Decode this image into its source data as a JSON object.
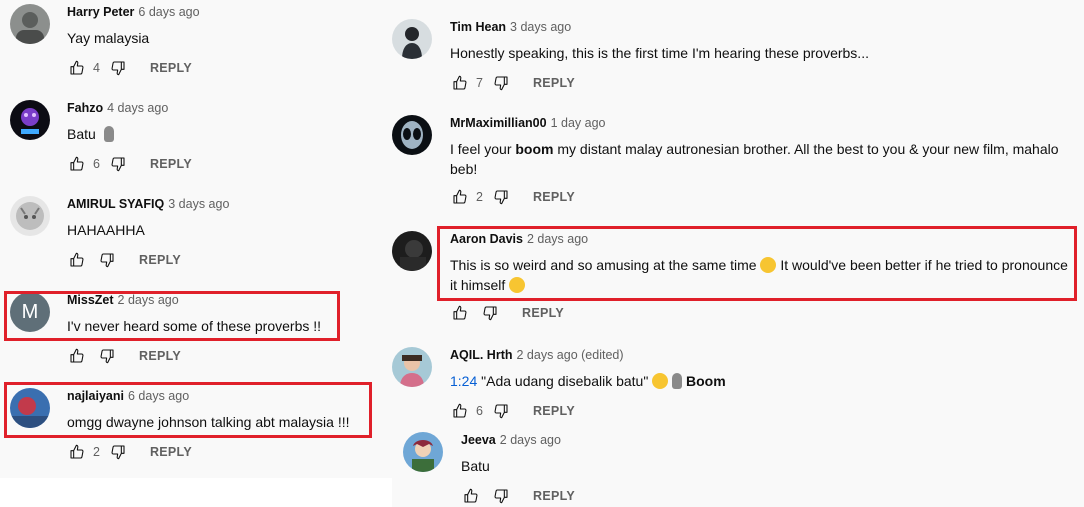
{
  "left": {
    "comments": [
      {
        "author": "Harry Peter",
        "time": "6 days ago",
        "text": "Yay malaysia",
        "likes": "4",
        "reply": "REPLY"
      },
      {
        "author": "Fahzo",
        "time": "4 days ago",
        "text": "Batu",
        "likes": "6",
        "reply": "REPLY"
      },
      {
        "author": "AMIRUL SYAFIQ",
        "time": "3 days ago",
        "text": "HAHAAHHA",
        "likes": "",
        "reply": "REPLY"
      },
      {
        "author": "MissZet",
        "time": "2 days ago",
        "text": "I'v never heard some of these proverbs !!",
        "likes": "",
        "reply": "REPLY",
        "avatar_letter": "M"
      },
      {
        "author": "najlaiyani",
        "time": "6 days ago",
        "text": "omgg dwayne johnson talking abt malaysia !!!",
        "likes": "2",
        "reply": "REPLY"
      }
    ]
  },
  "right": {
    "comments": [
      {
        "author": "Tim Hean",
        "time": "3 days ago",
        "text": "Honestly speaking, this is the first time I'm hearing these proverbs...",
        "likes": "7",
        "reply": "REPLY"
      },
      {
        "author": "MrMaximillian00",
        "time": "1 day ago",
        "text_pre": "I feel your ",
        "text_bold": "boom",
        "text_post": " my distant malay autronesian brother. All the best to you & your new film, mahalo",
        "text_line2": "beb!",
        "likes": "2",
        "reply": "REPLY"
      },
      {
        "author": "Aaron Davis",
        "time": "2 days ago",
        "text_a": "This is so weird and so amusing at the same time",
        "text_b": " It would've been better if he tried to pronounce",
        "text_line2": "it himself",
        "likes": "",
        "reply": "REPLY"
      },
      {
        "author": "AQIL. Hrth",
        "time": "2 days ago (edited)",
        "timestamp": "1:24",
        "text": " \"Ada udang disebalik batu\" ",
        "text_bold": "Boom",
        "likes": "6",
        "reply": "REPLY"
      },
      {
        "author": "Jeeva",
        "time": "2 days ago",
        "text": "Batu",
        "likes": "",
        "reply": "REPLY"
      }
    ]
  },
  "colors": {
    "highlight": "#e0202a",
    "link": "#065fd4",
    "meta": "#606060",
    "text": "#0f0f0f",
    "panel_bg": "#f9f9f9"
  },
  "icons": [
    "thumb-up-icon",
    "thumb-down-icon",
    "grinning-emoji-icon",
    "laughing-emoji-icon",
    "stone-emoji-icon"
  ]
}
